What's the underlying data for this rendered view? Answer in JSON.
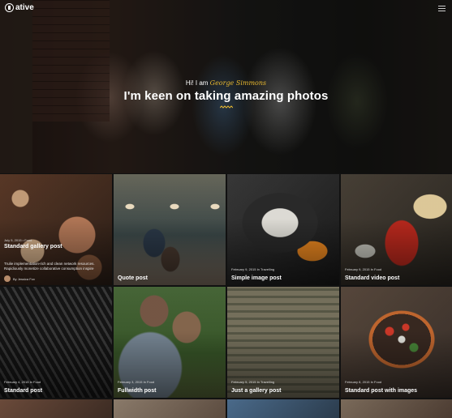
{
  "header": {
    "logo_text": "ative",
    "greeting_prefix": "Hi! I am",
    "greeting_name": "George Simmons",
    "headline": "I'm keen on taking amazing photos"
  },
  "colors": {
    "accent": "#e8b830"
  },
  "icons": {
    "menu": "hamburger-icon",
    "logo": "logo-mark-icon"
  },
  "posts": [
    {
      "title": "Standard gallery post",
      "meta": "July 5, 2015  •  Food",
      "excerpt": "Trulie implementation-rich and clean network resources. Rapidiously monetize collaborative consumption inspire",
      "author": "By Jessica Fox"
    },
    {
      "title": "Quote post",
      "meta": ""
    },
    {
      "title": "Simple image post",
      "meta": "February 9, 2015 In Travelling"
    },
    {
      "title": "Standard video post",
      "meta": "February 9, 2015 In Food"
    },
    {
      "title": "Standard post",
      "meta": "February 4, 2015 In Food"
    },
    {
      "title": "Fullwidth post",
      "meta": "February 3, 2015 In Food"
    },
    {
      "title": "Just a gallery post",
      "meta": "February 5, 2015 In Travelling"
    },
    {
      "title": "Standard post with images",
      "meta": "February 8, 2015 In Food"
    }
  ]
}
